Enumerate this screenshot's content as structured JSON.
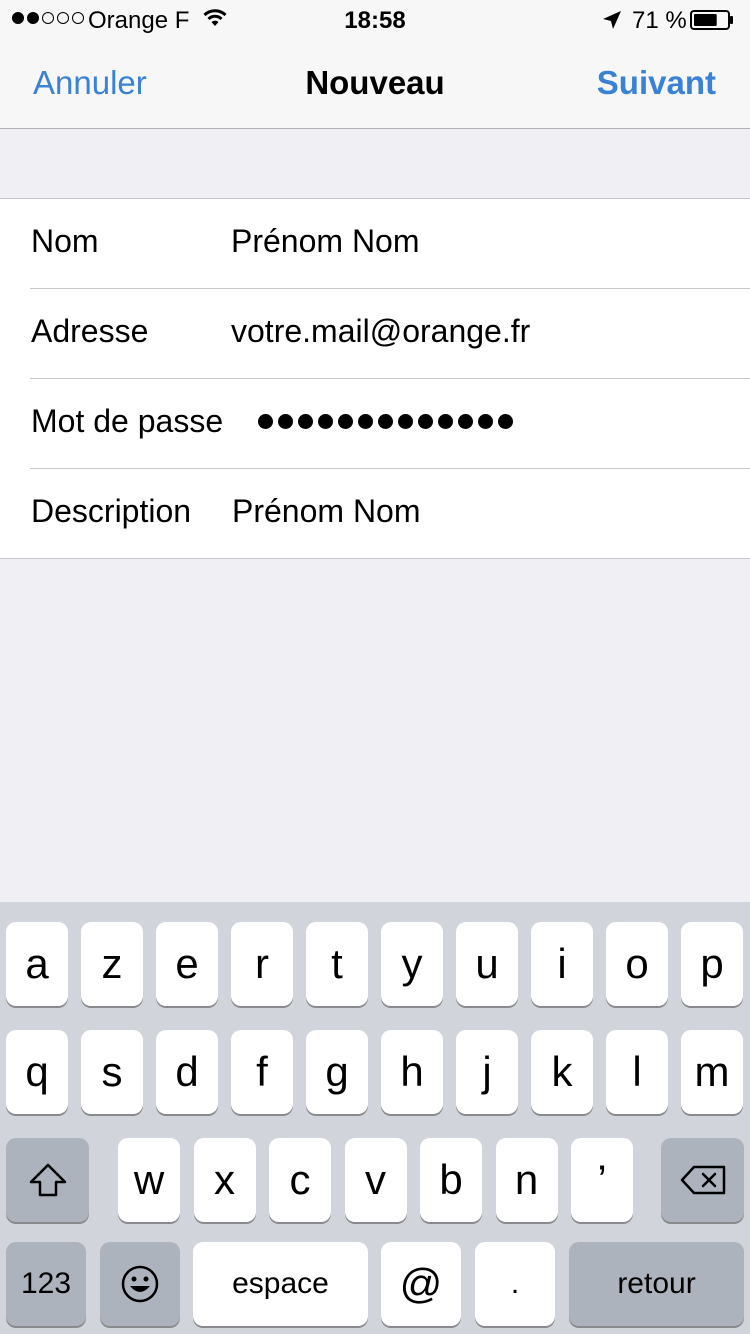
{
  "status_bar": {
    "signal_filled": 2,
    "signal_total": 5,
    "carrier": "Orange F",
    "time": "18:58",
    "battery_percent": "71 %",
    "battery_level": 0.71
  },
  "nav": {
    "cancel_label": "Annuler",
    "title": "Nouveau",
    "next_label": "Suivant",
    "accent_color": "#3a82d3"
  },
  "form": {
    "name": {
      "label": "Nom",
      "value": "Prénom Nom"
    },
    "address": {
      "label": "Adresse",
      "value": "votre.mail@orange.fr"
    },
    "password": {
      "label": "Mot de passe",
      "masked_length": 13
    },
    "description": {
      "label": "Description",
      "value": "Prénom Nom"
    }
  },
  "keyboard": {
    "row1": [
      "a",
      "z",
      "e",
      "r",
      "t",
      "y",
      "u",
      "i",
      "o",
      "p"
    ],
    "row2": [
      "q",
      "s",
      "d",
      "f",
      "g",
      "h",
      "j",
      "k",
      "l",
      "m"
    ],
    "row3": [
      "w",
      "x",
      "c",
      "v",
      "b",
      "n",
      "’"
    ],
    "shift_icon": "shift-icon",
    "backspace_icon": "backspace-icon",
    "numbers_label": "123",
    "emoji_icon": "emoji-icon",
    "space_label": "espace",
    "at_label": "@",
    "dot_label": ".",
    "return_label": "retour"
  }
}
